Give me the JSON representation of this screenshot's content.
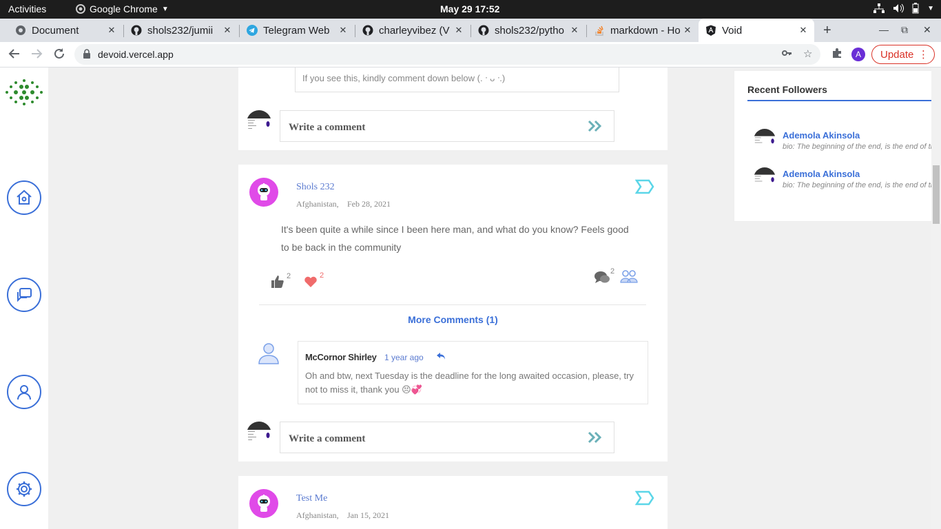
{
  "system": {
    "activities": "Activities",
    "app_name": "Google Chrome",
    "clock": "May 29  17:52"
  },
  "tabs": [
    {
      "title": "Document",
      "favicon": "globe-icon"
    },
    {
      "title": "shols232/jumii",
      "favicon": "github-icon"
    },
    {
      "title": "Telegram Web",
      "favicon": "telegram-icon"
    },
    {
      "title": "charleyvibez (V",
      "favicon": "github-icon"
    },
    {
      "title": "shols232/pytho",
      "favicon": "github-icon"
    },
    {
      "title": "markdown - Ho",
      "favicon": "stackoverflow-icon"
    },
    {
      "title": "Void",
      "favicon": "angular-icon"
    }
  ],
  "browser": {
    "url": "devoid.vercel.app",
    "update_label": "Update",
    "profile_initial": "A"
  },
  "top_card": {
    "reply_text": "If you see this, kindly comment down below (. ᐧ ᴗ ᐧ.)",
    "comment_placeholder": "Write a comment"
  },
  "post1": {
    "author": "Shols 232",
    "country": "Afghanistan,",
    "date": "Feb 28, 2021",
    "body_line1": "It's been quite a while since I been here man, and what do you know? Feels good",
    "body_line2": "to be back in the community",
    "likes": "2",
    "hearts": "2",
    "comments": "2",
    "more_comments": "More Comments (1)",
    "reply": {
      "name": "McCornor Shirley",
      "time": "1 year ago",
      "text_line1": "Oh and btw, next Tuesday is the deadline for the long awaited occasion, please, try",
      "text_line2": "not to miss it, thank you 😣💞"
    },
    "comment_placeholder": "Write a comment"
  },
  "post2": {
    "author": "Test Me",
    "country": "Afghanistan,",
    "date": "Jan 15, 2021"
  },
  "sidebar": {
    "title": "Recent Followers",
    "followers": [
      {
        "name": "Ademola Akinsola",
        "bio": "bio: The beginning of the end, is the end of the beginning"
      },
      {
        "name": "Ademola Akinsola",
        "bio": "bio: The beginning of the end, is the end of the beginning"
      }
    ]
  },
  "colors": {
    "accent": "#3a6fd8",
    "robot_bg": "#e04ae8",
    "tag": "#5bd6e8",
    "heart": "#f06b6b",
    "update": "#d93025"
  }
}
